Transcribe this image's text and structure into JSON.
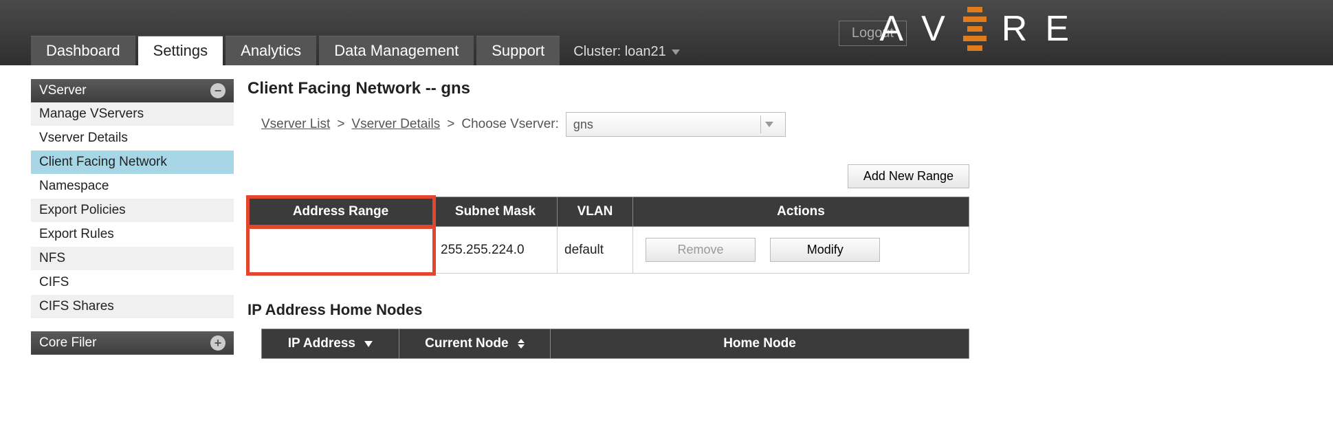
{
  "header": {
    "logout": "Logout",
    "logo_letters": [
      "A",
      "V",
      "R",
      "E"
    ],
    "tabs": [
      "Dashboard",
      "Settings",
      "Analytics",
      "Data Management",
      "Support"
    ],
    "active_tab_index": 1,
    "cluster_label": "Cluster: loan21"
  },
  "sidebar": {
    "sections": [
      {
        "title": "VServer",
        "icon": "minus",
        "items": [
          "Manage VServers",
          "Vserver Details",
          "Client Facing Network",
          "Namespace",
          "Export Policies",
          "Export Rules",
          "NFS",
          "CIFS",
          "CIFS Shares"
        ],
        "selected_index": 2
      },
      {
        "title": "Core Filer",
        "icon": "plus",
        "items": []
      }
    ]
  },
  "page": {
    "title": "Client Facing Network -- gns",
    "breadcrumb": {
      "vserver_list": "Vserver List",
      "vserver_details": "Vserver Details",
      "choose_label": "Choose Vserver:",
      "selected_vserver": "gns"
    },
    "add_range_label": "Add New Range",
    "range_table": {
      "headers": [
        "Address Range",
        "Subnet Mask",
        "VLAN",
        "Actions"
      ],
      "rows": [
        {
          "address_range": "",
          "subnet_mask": "255.255.224.0",
          "vlan": "default"
        }
      ],
      "action_labels": {
        "remove": "Remove",
        "modify": "Modify"
      }
    },
    "ip_section_title": "IP Address Home Nodes",
    "ip_table": {
      "headers": [
        "IP Address",
        "Current Node",
        "Home Node"
      ]
    }
  }
}
